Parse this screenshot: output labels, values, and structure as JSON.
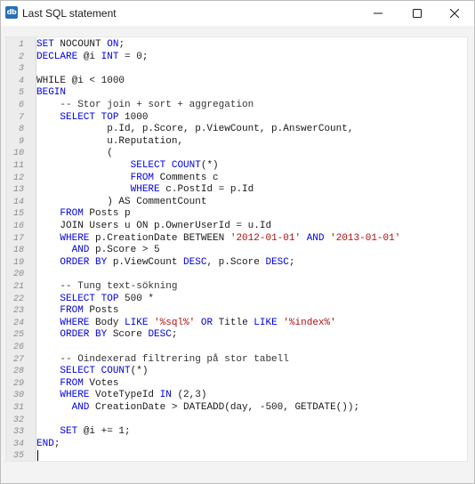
{
  "window": {
    "title": "Last SQL statement",
    "icon": "db-app-icon",
    "icon_text": "db",
    "controls": [
      "minimize-icon",
      "maximize-icon",
      "close-icon"
    ]
  },
  "colors": {
    "keyword": "#0000e6",
    "string": "#b20f0f",
    "text": "#1a1a1a",
    "gutter": "#ececec"
  },
  "editor": {
    "lines": [
      [
        [
          "kw",
          "SET"
        ],
        [
          "p",
          " NOCOUNT "
        ],
        [
          "kw",
          "ON"
        ],
        [
          "p",
          ";"
        ]
      ],
      [
        [
          "kw",
          "DECLARE"
        ],
        [
          "p",
          " @i "
        ],
        [
          "kw",
          "INT"
        ],
        [
          "p",
          " = 0;"
        ]
      ],
      [],
      [
        [
          "p",
          "WHILE @i < 1000"
        ]
      ],
      [
        [
          "kw",
          "BEGIN"
        ]
      ],
      [
        [
          "c",
          "    -- Stor join + sort + aggregation"
        ]
      ],
      [
        [
          "p",
          "    "
        ],
        [
          "kw",
          "SELECT TOP"
        ],
        [
          "p",
          " 1000"
        ]
      ],
      [
        [
          "p",
          "            p.Id, p.Score, p.ViewCount, p.AnswerCount,"
        ]
      ],
      [
        [
          "p",
          "            u.Reputation,"
        ]
      ],
      [
        [
          "p",
          "            ("
        ]
      ],
      [
        [
          "p",
          "                "
        ],
        [
          "kw",
          "SELECT"
        ],
        [
          "p",
          " "
        ],
        [
          "kw",
          "COUNT"
        ],
        [
          "p",
          "(*)"
        ]
      ],
      [
        [
          "p",
          "                "
        ],
        [
          "kw",
          "FROM"
        ],
        [
          "p",
          " Comments c"
        ]
      ],
      [
        [
          "p",
          "                "
        ],
        [
          "kw",
          "WHERE"
        ],
        [
          "p",
          " c.PostId = p.Id"
        ]
      ],
      [
        [
          "p",
          "            ) AS CommentCount"
        ]
      ],
      [
        [
          "p",
          "    "
        ],
        [
          "kw",
          "FROM"
        ],
        [
          "p",
          " Posts p"
        ]
      ],
      [
        [
          "p",
          "    JOIN Users u ON p.OwnerUserId = u.Id"
        ]
      ],
      [
        [
          "p",
          "    "
        ],
        [
          "kw",
          "WHERE"
        ],
        [
          "p",
          " p.CreationDate BETWEEN "
        ],
        [
          "s",
          "'2012-01-01'"
        ],
        [
          "p",
          " "
        ],
        [
          "kw",
          "AND"
        ],
        [
          "p",
          " "
        ],
        [
          "s",
          "'2013-01-01'"
        ]
      ],
      [
        [
          "p",
          "      "
        ],
        [
          "kw",
          "AND"
        ],
        [
          "p",
          " p.Score > 5"
        ]
      ],
      [
        [
          "p",
          "    "
        ],
        [
          "kw",
          "ORDER BY"
        ],
        [
          "p",
          " p.ViewCount "
        ],
        [
          "kw",
          "DESC"
        ],
        [
          "p",
          ", p.Score "
        ],
        [
          "kw",
          "DESC"
        ],
        [
          "p",
          ";"
        ]
      ],
      [],
      [
        [
          "c",
          "    -- Tung text-sökning"
        ]
      ],
      [
        [
          "p",
          "    "
        ],
        [
          "kw",
          "SELECT TOP"
        ],
        [
          "p",
          " 500 *"
        ]
      ],
      [
        [
          "p",
          "    "
        ],
        [
          "kw",
          "FROM"
        ],
        [
          "p",
          " Posts"
        ]
      ],
      [
        [
          "p",
          "    "
        ],
        [
          "kw",
          "WHERE"
        ],
        [
          "p",
          " Body "
        ],
        [
          "kw",
          "LIKE"
        ],
        [
          "p",
          " "
        ],
        [
          "s",
          "'%sql%'"
        ],
        [
          "p",
          " "
        ],
        [
          "kw",
          "OR"
        ],
        [
          "p",
          " Title "
        ],
        [
          "kw",
          "LIKE"
        ],
        [
          "p",
          " "
        ],
        [
          "s",
          "'%index%'"
        ]
      ],
      [
        [
          "p",
          "    "
        ],
        [
          "kw",
          "ORDER BY"
        ],
        [
          "p",
          " Score "
        ],
        [
          "kw",
          "DESC"
        ],
        [
          "p",
          ";"
        ]
      ],
      [],
      [
        [
          "c",
          "    -- Oindexerad filtrering på stor tabell"
        ]
      ],
      [
        [
          "p",
          "    "
        ],
        [
          "kw",
          "SELECT"
        ],
        [
          "p",
          " "
        ],
        [
          "kw",
          "COUNT"
        ],
        [
          "p",
          "(*)"
        ]
      ],
      [
        [
          "p",
          "    "
        ],
        [
          "kw",
          "FROM"
        ],
        [
          "p",
          " Votes"
        ]
      ],
      [
        [
          "p",
          "    "
        ],
        [
          "kw",
          "WHERE"
        ],
        [
          "p",
          " VoteTypeId "
        ],
        [
          "kw",
          "IN"
        ],
        [
          "p",
          " (2,3)"
        ]
      ],
      [
        [
          "p",
          "      "
        ],
        [
          "kw",
          "AND"
        ],
        [
          "p",
          " CreationDate > DATEADD(day, -500, GETDATE());"
        ]
      ],
      [],
      [
        [
          "p",
          "    "
        ],
        [
          "kw",
          "SET"
        ],
        [
          "p",
          " @i += 1;"
        ]
      ],
      [
        [
          "kw",
          "END"
        ],
        [
          "p",
          ";"
        ]
      ],
      []
    ]
  }
}
